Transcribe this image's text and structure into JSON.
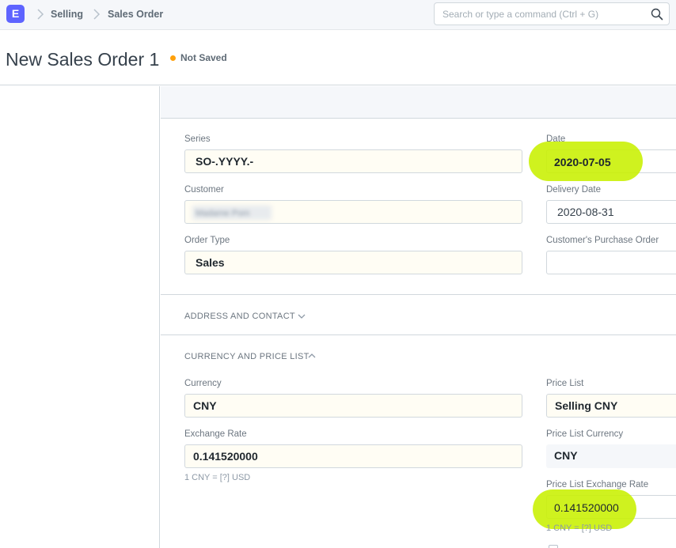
{
  "navbar": {
    "logo_letter": "E",
    "breadcrumbs": [
      "Selling",
      "Sales Order"
    ],
    "search": {
      "placeholder": "Search or type a command (Ctrl + G)",
      "value": ""
    }
  },
  "page": {
    "title": "New Sales Order 1",
    "status": "Not Saved",
    "status_color": "#ffa00a"
  },
  "form": {
    "series": {
      "label": "Series",
      "value": "SO-.YYYY.-"
    },
    "customer": {
      "label": "Customer",
      "value": "Madame Pom"
    },
    "order_type": {
      "label": "Order Type",
      "value": "Sales"
    },
    "date": {
      "label": "Date",
      "value": "2020-07-05"
    },
    "delivery_date": {
      "label": "Delivery Date",
      "value": "2020-08-31"
    },
    "customer_po": {
      "label": "Customer's Purchase Order",
      "value": ""
    },
    "address_section": {
      "title": "ADDRESS AND CONTACT"
    },
    "currency_section": {
      "title": "CURRENCY AND PRICE LIST"
    },
    "currency": {
      "label": "Currency",
      "value": "CNY"
    },
    "exchange_rate": {
      "label": "Exchange Rate",
      "value": "0.141520000",
      "help": "1 CNY = [?] USD"
    },
    "price_list": {
      "label": "Price List",
      "value": "Selling CNY"
    },
    "price_list_currency": {
      "label": "Price List Currency",
      "value": "CNY"
    },
    "price_list_exchange_rate": {
      "label": "Price List Exchange Rate",
      "value": "0.141520000",
      "help": "1 CNY = [?] USD"
    }
  },
  "colors": {
    "accent": "#5e64ff",
    "highlight": "#c8f000"
  },
  "icons": [
    "chevron-right-icon",
    "search-icon",
    "chevron-down-icon",
    "chevron-up-icon"
  ]
}
